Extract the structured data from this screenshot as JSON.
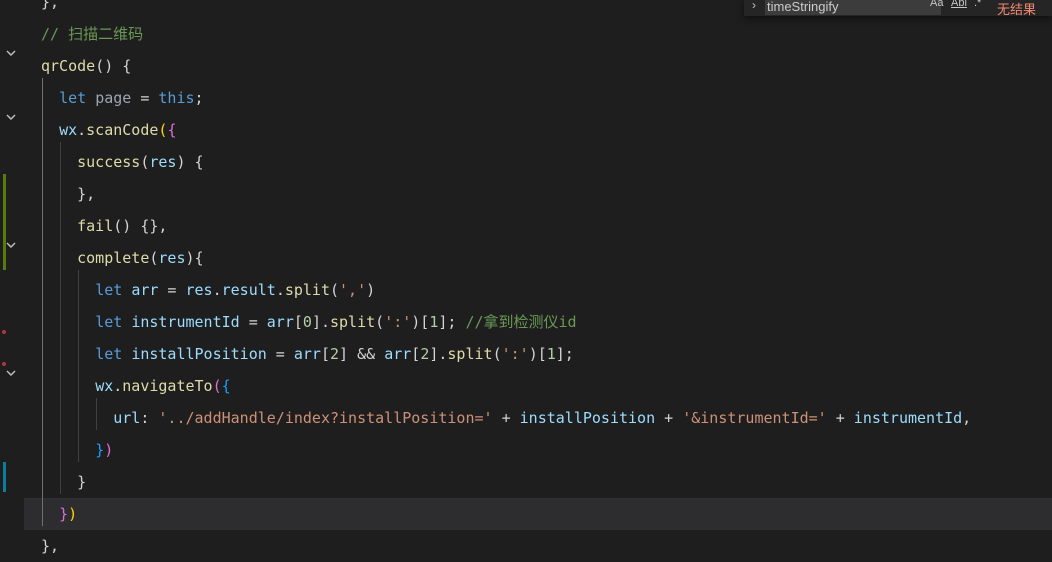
{
  "editor": {
    "lines": [
      [
        {
          "t": "},",
          "c": "pun"
        }
      ],
      [
        {
          "t": "// 扫描二维码",
          "c": "cmt"
        }
      ],
      [
        {
          "t": "qrCode",
          "c": "fn"
        },
        {
          "t": "() ",
          "c": "pun"
        },
        {
          "t": "{",
          "c": "pun"
        }
      ],
      [
        {
          "t": "  ",
          "c": "pun"
        },
        {
          "t": "let",
          "c": "kwb"
        },
        {
          "t": " ",
          "c": "pun"
        },
        {
          "t": "page",
          "c": "dim"
        },
        {
          "t": " = ",
          "c": "pun"
        },
        {
          "t": "this",
          "c": "kwb"
        },
        {
          "t": ";",
          "c": "pun"
        }
      ],
      [
        {
          "t": "  ",
          "c": "pun"
        },
        {
          "t": "wx",
          "c": "var"
        },
        {
          "t": ".",
          "c": "pun"
        },
        {
          "t": "scanCode",
          "c": "fn"
        },
        {
          "t": "(",
          "c": "brk1"
        },
        {
          "t": "{",
          "c": "brk2"
        }
      ],
      [
        {
          "t": "    ",
          "c": "pun"
        },
        {
          "t": "success",
          "c": "fn"
        },
        {
          "t": "(",
          "c": "pun"
        },
        {
          "t": "res",
          "c": "var"
        },
        {
          "t": ") {",
          "c": "pun"
        }
      ],
      [
        {
          "t": "    ",
          "c": "pun"
        },
        {
          "t": "},",
          "c": "pun"
        }
      ],
      [
        {
          "t": "    ",
          "c": "pun"
        },
        {
          "t": "fail",
          "c": "fn"
        },
        {
          "t": "() {},",
          "c": "pun"
        }
      ],
      [
        {
          "t": "    ",
          "c": "pun"
        },
        {
          "t": "complete",
          "c": "fn"
        },
        {
          "t": "(",
          "c": "pun"
        },
        {
          "t": "res",
          "c": "var"
        },
        {
          "t": "){",
          "c": "pun"
        }
      ],
      [
        {
          "t": "      ",
          "c": "pun"
        },
        {
          "t": "let",
          "c": "kwb"
        },
        {
          "t": " ",
          "c": "pun"
        },
        {
          "t": "arr",
          "c": "var"
        },
        {
          "t": " = ",
          "c": "pun"
        },
        {
          "t": "res",
          "c": "var"
        },
        {
          "t": ".",
          "c": "pun"
        },
        {
          "t": "result",
          "c": "var"
        },
        {
          "t": ".",
          "c": "pun"
        },
        {
          "t": "split",
          "c": "fn"
        },
        {
          "t": "(",
          "c": "pun"
        },
        {
          "t": "','",
          "c": "str"
        },
        {
          "t": ")",
          "c": "pun"
        }
      ],
      [
        {
          "t": "      ",
          "c": "pun"
        },
        {
          "t": "let",
          "c": "kwb"
        },
        {
          "t": " ",
          "c": "pun"
        },
        {
          "t": "instrumentId",
          "c": "var"
        },
        {
          "t": " = ",
          "c": "pun"
        },
        {
          "t": "arr",
          "c": "var"
        },
        {
          "t": "[",
          "c": "pun"
        },
        {
          "t": "0",
          "c": "num"
        },
        {
          "t": "].",
          "c": "pun"
        },
        {
          "t": "split",
          "c": "fn"
        },
        {
          "t": "(",
          "c": "pun"
        },
        {
          "t": "':'",
          "c": "str"
        },
        {
          "t": ")[",
          "c": "pun"
        },
        {
          "t": "1",
          "c": "num"
        },
        {
          "t": "]; ",
          "c": "pun"
        },
        {
          "t": "//拿到检测仪id",
          "c": "cmt"
        }
      ],
      [
        {
          "t": "      ",
          "c": "pun"
        },
        {
          "t": "let",
          "c": "kwb"
        },
        {
          "t": " ",
          "c": "pun"
        },
        {
          "t": "installPosition",
          "c": "var"
        },
        {
          "t": " = ",
          "c": "pun"
        },
        {
          "t": "arr",
          "c": "var"
        },
        {
          "t": "[",
          "c": "pun"
        },
        {
          "t": "2",
          "c": "num"
        },
        {
          "t": "] && ",
          "c": "pun"
        },
        {
          "t": "arr",
          "c": "var"
        },
        {
          "t": "[",
          "c": "pun"
        },
        {
          "t": "2",
          "c": "num"
        },
        {
          "t": "].",
          "c": "pun"
        },
        {
          "t": "split",
          "c": "fn"
        },
        {
          "t": "(",
          "c": "pun"
        },
        {
          "t": "':'",
          "c": "str"
        },
        {
          "t": ")[",
          "c": "pun"
        },
        {
          "t": "1",
          "c": "num"
        },
        {
          "t": "];",
          "c": "pun"
        }
      ],
      [
        {
          "t": "      ",
          "c": "pun"
        },
        {
          "t": "wx",
          "c": "var"
        },
        {
          "t": ".",
          "c": "pun"
        },
        {
          "t": "navigateTo",
          "c": "fn"
        },
        {
          "t": "(",
          "c": "brk2"
        },
        {
          "t": "{",
          "c": "brk3"
        }
      ],
      [
        {
          "t": "        ",
          "c": "pun"
        },
        {
          "t": "url",
          "c": "var"
        },
        {
          "t": ": ",
          "c": "pun"
        },
        {
          "t": "'../addHandle/index?installPosition='",
          "c": "str"
        },
        {
          "t": " + ",
          "c": "pun"
        },
        {
          "t": "installPosition",
          "c": "var"
        },
        {
          "t": " + ",
          "c": "pun"
        },
        {
          "t": "'&instrumentId='",
          "c": "str"
        },
        {
          "t": " + ",
          "c": "pun"
        },
        {
          "t": "instrumentId",
          "c": "var"
        },
        {
          "t": ",",
          "c": "pun"
        }
      ],
      [
        {
          "t": "      ",
          "c": "pun"
        },
        {
          "t": "}",
          "c": "brk3"
        },
        {
          "t": ")",
          "c": "brk2"
        }
      ],
      [
        {
          "t": "    ",
          "c": "pun"
        },
        {
          "t": "}",
          "c": "pun"
        }
      ],
      [
        {
          "t": "  ",
          "c": "pun"
        },
        {
          "t": "}",
          "c": "brk2"
        },
        {
          "t": ")",
          "c": "brk1"
        }
      ],
      [
        {
          "t": "},",
          "c": "pun"
        }
      ]
    ],
    "current_line": 16
  },
  "find_widget": {
    "toggle_glyph": "›",
    "query": "timeStringify",
    "match_case": "Aa",
    "whole_word": "Abl",
    "regex": ".*",
    "result": "无结果"
  }
}
